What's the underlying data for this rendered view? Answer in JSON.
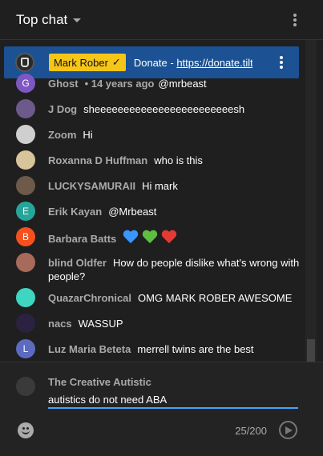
{
  "header": {
    "title": "Top chat",
    "caret_icon": "chevron-down-icon",
    "menu_icon": "more-vert-icon"
  },
  "pinned": {
    "author": "Mark Rober",
    "badge_icon": "verified-check-icon",
    "text_prefix": "Donate - ",
    "link_text": "https://donate.tiltif",
    "menu_icon": "more-vert-icon",
    "bg_color": "#1c5293",
    "badge_color": "#f5c518"
  },
  "messages": [
    {
      "author": "Ghost",
      "timestamp": "• 14 years ago",
      "text": "@mrbeast",
      "avatar_letter": "G",
      "avatar_color": "#7e57c2"
    },
    {
      "author": "J Dog",
      "text": "sheeeeeeeeeeeeeeeeeeeeeeeesh",
      "avatar_letter": "",
      "avatar_color": "#6b5a8a"
    },
    {
      "author": "Zoom",
      "text": "Hi",
      "avatar_letter": "",
      "avatar_color": "#cfcfcf"
    },
    {
      "author": "Roxanna D Huffman",
      "text": "who is this",
      "avatar_letter": "",
      "avatar_color": "#d8c49a"
    },
    {
      "author": "LUCKYSAMURAII",
      "text": "Hi mark",
      "avatar_letter": "",
      "avatar_color": "#6e5a4a"
    },
    {
      "author": "Erik Kayan",
      "text": "@Mrbeast",
      "avatar_letter": "E",
      "avatar_color": "#26a69a"
    },
    {
      "author": "Barbara Batts",
      "text": "",
      "hearts": [
        "#3b95ff",
        "#5cbf40",
        "#e53935"
      ],
      "avatar_letter": "B",
      "avatar_color": "#f4511e"
    },
    {
      "author": "blind Oldfer",
      "text": "How do people dislike what's wrong with people?",
      "avatar_letter": "",
      "avatar_color": "#a86a5a"
    },
    {
      "author": "QuazarChronical",
      "text": "OMG MARK ROBER AWESOME",
      "avatar_letter": "",
      "avatar_color": "#3ed6c0"
    },
    {
      "author": "nacs",
      "text": "WASSUP",
      "avatar_letter": "",
      "avatar_color": "#2a2240"
    },
    {
      "author": "Luz Maria Beteta",
      "text": "merrell twins are the best",
      "avatar_letter": "L",
      "avatar_color": "#5c6bc0"
    }
  ],
  "input": {
    "user_name": "The Creative Autistic",
    "value": "autistics do not need ABA",
    "counter": "25/200",
    "emoji_icon": "emoji-icon",
    "send_icon": "send-icon",
    "accent_color": "#3ea6ff"
  }
}
